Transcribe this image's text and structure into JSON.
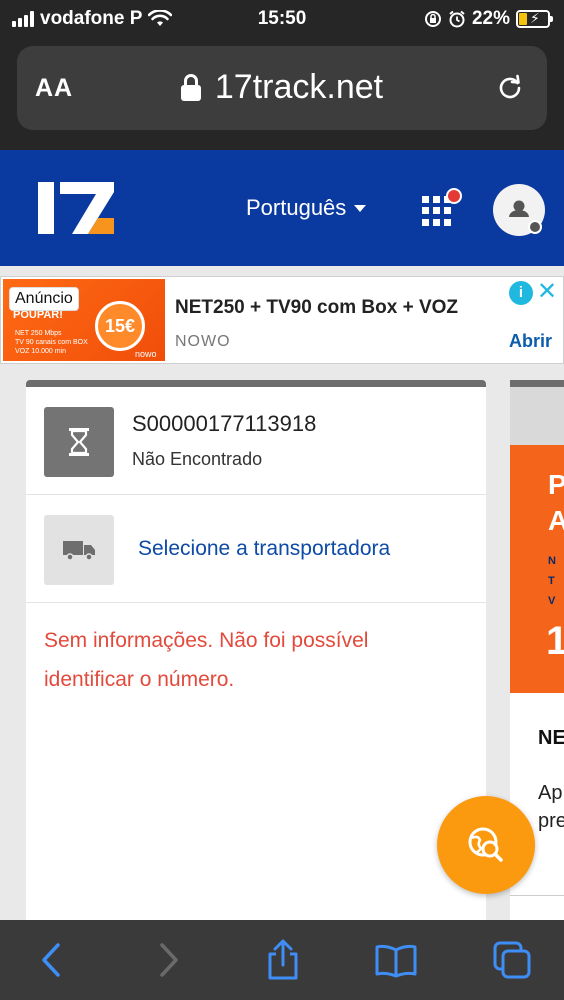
{
  "status_bar": {
    "carrier": "vodafone P",
    "time": "15:50",
    "battery": "22%"
  },
  "browser": {
    "text_size_label": "AA",
    "url": "17track.net"
  },
  "header": {
    "logo_text": "17",
    "language": "Português"
  },
  "ad": {
    "badge": "Anúncio",
    "title": "NET250 + TV90 com Box + VOZ",
    "advertiser": "NOWO",
    "cta": "Abrir",
    "image_text": {
      "headline": "POUPAR!",
      "price": "15€",
      "lines": [
        "NET 250 Mbps",
        "TV 90 canais com BOX",
        "VOZ 10.000 min"
      ],
      "brand": "nowo"
    },
    "info_icon": "info-icon",
    "close_icon": "close-icon"
  },
  "tracking": {
    "number": "S00000177113918",
    "status": "Não Encontrado",
    "select_carrier": "Selecione a transportadora",
    "error_message": "Sem informações. Não foi possível identificar o número."
  },
  "side_card": {
    "line1": "P",
    "line2": "A",
    "small_lines": [
      "N",
      "T",
      "V"
    ],
    "big": "1",
    "heading": "NE",
    "body_lines": [
      "Ap",
      "pre"
    ]
  },
  "colors": {
    "header_blue": "#0a3aa0",
    "accent_orange": "#fb9a0f",
    "error_red": "#e24a3c",
    "link_blue": "#0e4aa6",
    "safari_blue": "#3f8ef5"
  },
  "toolbar_icons": [
    "back-icon",
    "forward-icon",
    "share-icon",
    "bookmarks-icon",
    "tabs-icon"
  ]
}
